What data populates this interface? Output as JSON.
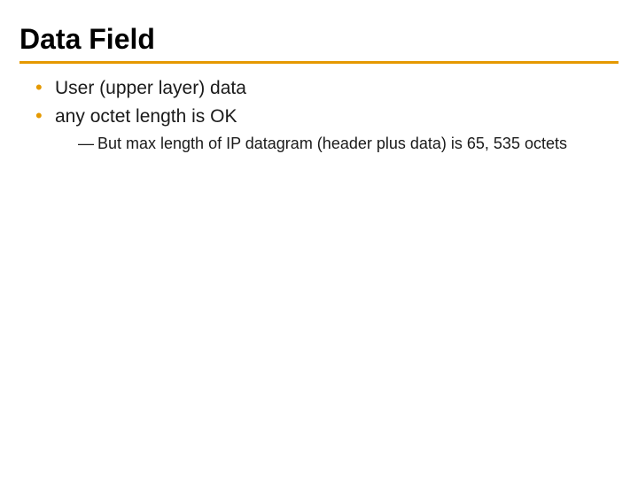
{
  "title": "Data Field",
  "bullets": [
    {
      "text": "User (upper layer) data"
    },
    {
      "text": "any octet length is OK"
    }
  ],
  "sub_bullets": [
    {
      "dash": "—",
      "text": "But max length of IP datagram (header plus data) is 65, 535 octets"
    }
  ]
}
